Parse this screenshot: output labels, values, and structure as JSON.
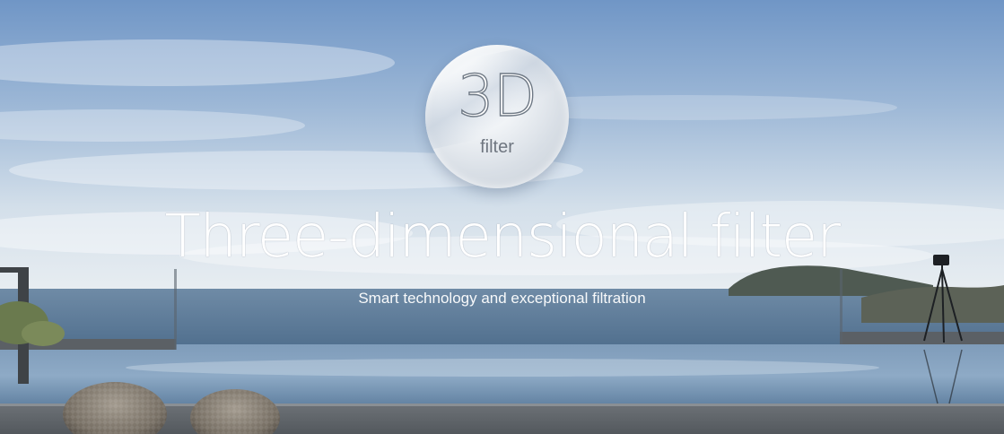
{
  "badge": {
    "main": "3D",
    "sub": "filter"
  },
  "hero": {
    "headline": "Three-dimensional filter",
    "tagline": "Smart technology and exceptional filtration"
  },
  "colors": {
    "sky_top": "#6f93c3",
    "sky_bottom": "#dde6ee",
    "sea": "#5d7f9e",
    "deck": "#5f6469",
    "text": "#ffffff"
  },
  "icons": [
    "3d-filter-badge-icon"
  ]
}
